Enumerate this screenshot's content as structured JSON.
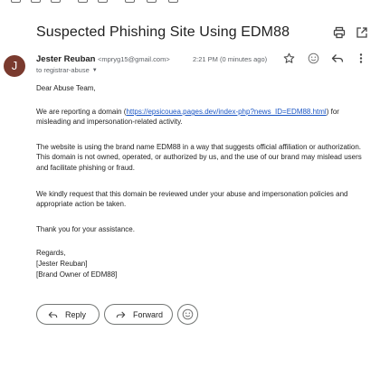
{
  "email": {
    "subject": "Suspected Phishing Site Using EDM88",
    "sender": {
      "initial": "J",
      "name": "Jester Reuban",
      "email": "<mpryg15@gmail.com>"
    },
    "timestamp": "2:21 PM (0 minutes ago)",
    "recipient": "to registrar-abuse",
    "body": {
      "greeting": "Dear Abuse Team,",
      "p1_before": "We are reporting a domain (",
      "p1_link": "https://epsicouea.pages.dev/index-php?news_ID=EDM88.html",
      "p1_after": ") for misleading and impersonation-related activity.",
      "p2": "The website is using the brand name EDM88 in a way that suggests official affiliation or authorization. This domain is not owned, operated, or authorized by us, and the use of our brand may mislead users and facilitate phishing or fraud.",
      "p3": "We kindly request that this domain be reviewed under your abuse and impersonation policies and appropriate action be taken.",
      "p4": "Thank you for your assistance.",
      "sig1": "Regards,",
      "sig2": "[Jester Reuban]",
      "sig3": "[Brand Owner of EDM88]"
    }
  },
  "actions": {
    "reply_label": "Reply",
    "forward_label": "Forward"
  },
  "colors": {
    "avatar": "#7a3a2e",
    "link": "#1a55c4"
  },
  "icons": [
    "print-icon",
    "open-in-new-window-icon",
    "star-icon",
    "emoji-icon",
    "reply-icon",
    "more-options-icon",
    "forward-icon"
  ]
}
